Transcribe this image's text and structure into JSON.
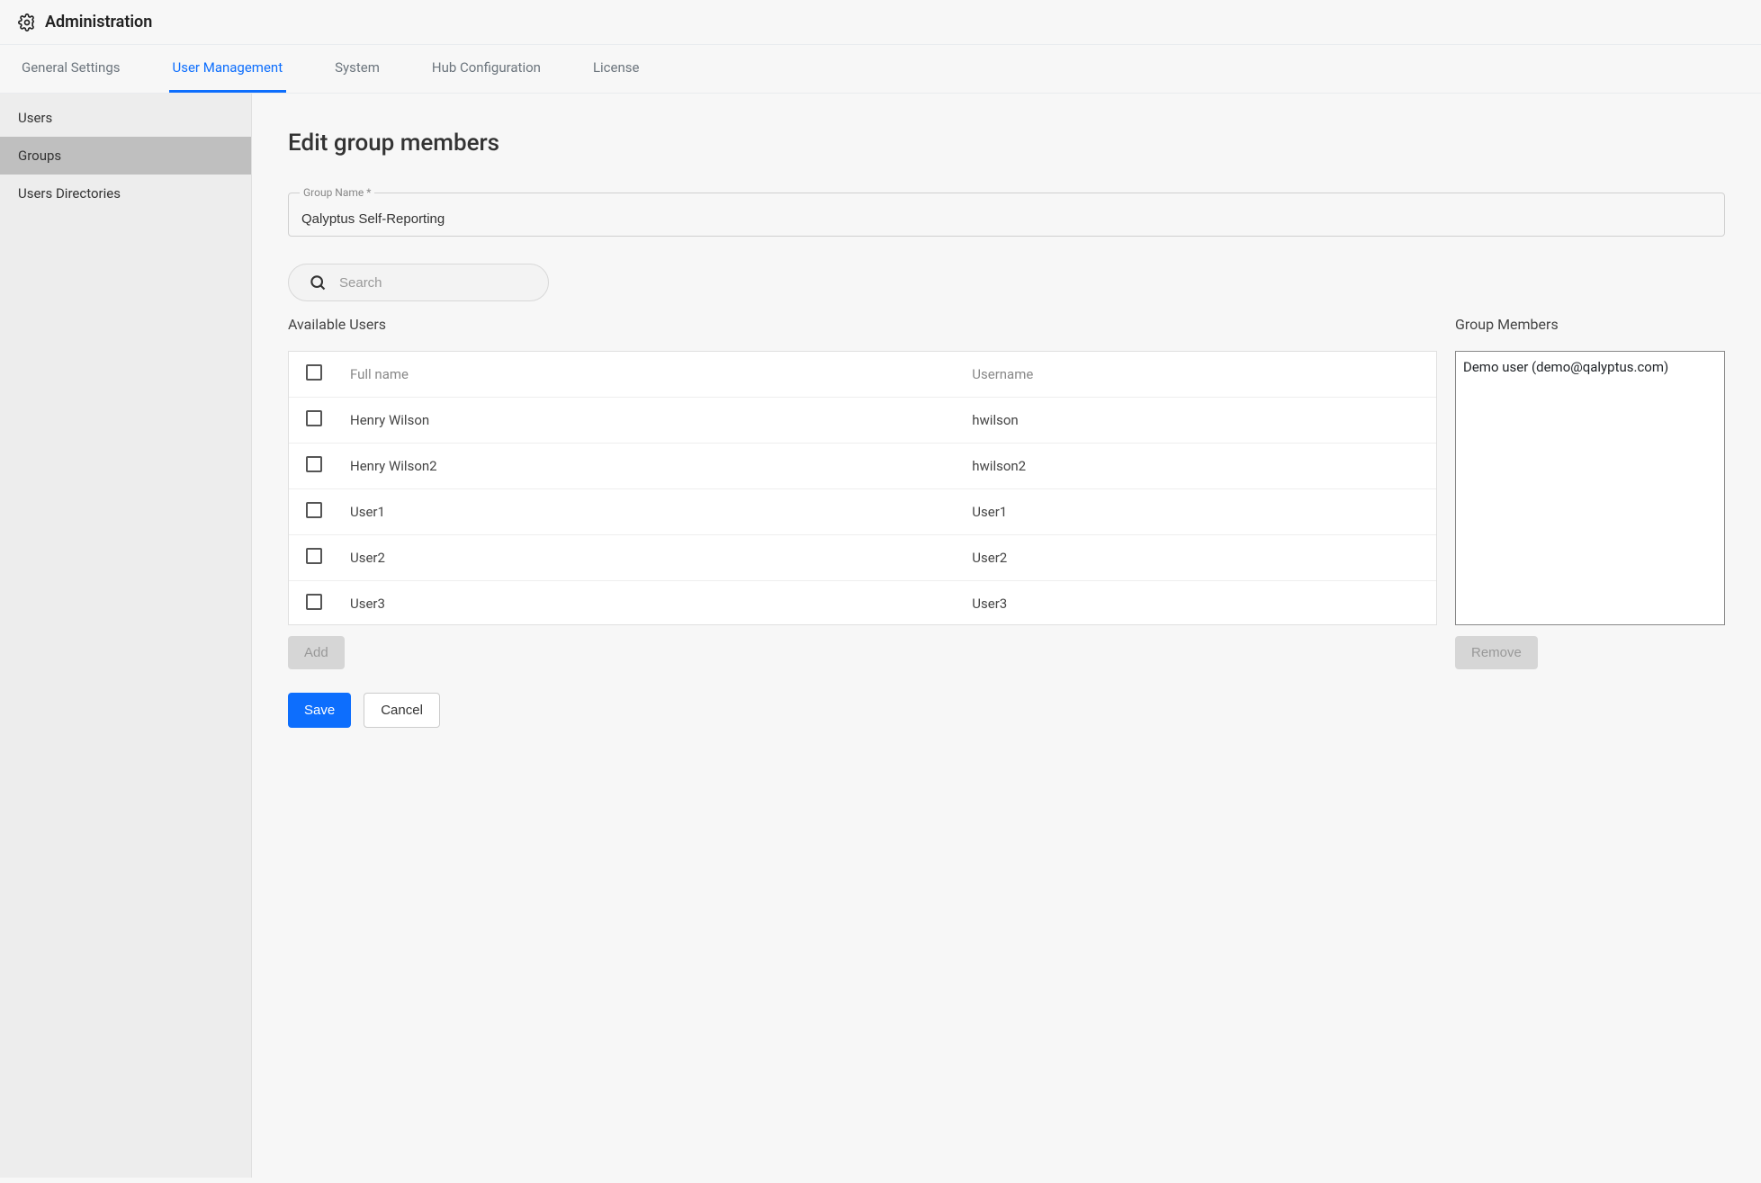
{
  "header": {
    "title": "Administration"
  },
  "tabs": [
    {
      "label": "General Settings",
      "active": false
    },
    {
      "label": "User Management",
      "active": true
    },
    {
      "label": "System",
      "active": false
    },
    {
      "label": "Hub Configuration",
      "active": false
    },
    {
      "label": "License",
      "active": false
    }
  ],
  "sidebar": {
    "items": [
      {
        "label": "Users",
        "selected": false
      },
      {
        "label": "Groups",
        "selected": true
      },
      {
        "label": "Users Directories",
        "selected": false
      }
    ]
  },
  "page": {
    "title": "Edit group members",
    "group_name_label": "Group Name *",
    "group_name_value": "Qalyptus Self-Reporting",
    "search_placeholder": "Search",
    "available_users_label": "Available Users",
    "group_members_label": "Group Members",
    "add_label": "Add",
    "remove_label": "Remove",
    "save_label": "Save",
    "cancel_label": "Cancel",
    "table": {
      "col_fullname": "Full name",
      "col_username": "Username",
      "rows": [
        {
          "fullname": "Henry Wilson",
          "username": "hwilson"
        },
        {
          "fullname": "Henry Wilson2",
          "username": "hwilson2"
        },
        {
          "fullname": "User1",
          "username": "User1"
        },
        {
          "fullname": "User2",
          "username": "User2"
        },
        {
          "fullname": "User3",
          "username": "User3"
        }
      ]
    },
    "members": [
      {
        "display": "Demo user (demo@qalyptus.com)"
      }
    ]
  }
}
